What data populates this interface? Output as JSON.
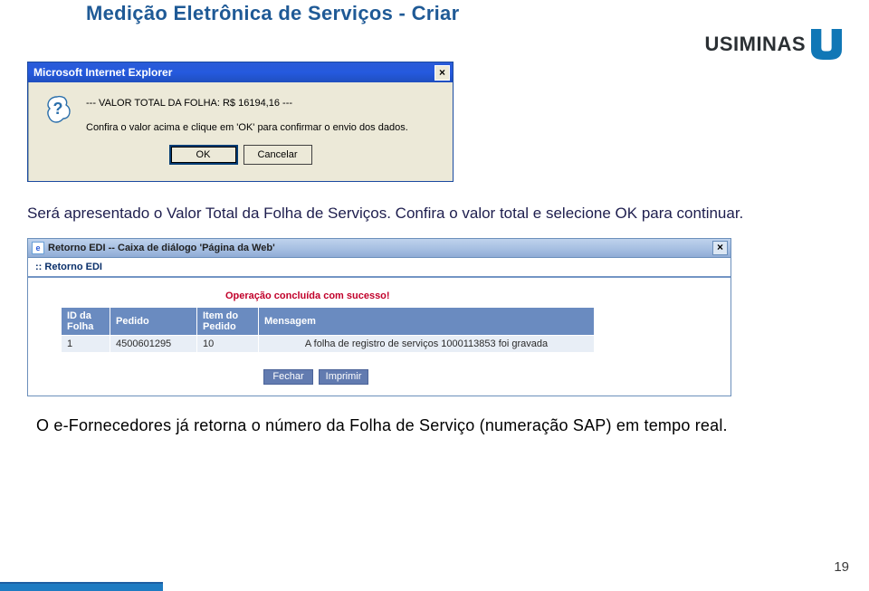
{
  "header": {
    "page_title": "Medição Eletrônica de Serviços - Criar",
    "logo_text": "USIMINAS"
  },
  "ie_dialog": {
    "title": "Microsoft Internet Explorer",
    "line1": "--- VALOR TOTAL DA FOLHA: R$ 16194,16 ---",
    "line2": "Confira o valor acima e clique em 'OK' para confirmar o envio dos dados.",
    "ok_label": "OK",
    "cancel_label": "Cancelar"
  },
  "instruction": "Será apresentado o Valor Total da Folha de Serviços. Confira o valor total e selecione OK para continuar.",
  "web_dialog": {
    "titlebar": "Retorno EDI -- Caixa de diálogo 'Página da Web'",
    "retorno_label": ":: Retorno EDI",
    "success_message": "Operação concluída com sucesso!",
    "table": {
      "headers": {
        "id": "ID da Folha",
        "pedido": "Pedido",
        "item": "Item do Pedido",
        "mensagem": "Mensagem"
      },
      "row": {
        "id": "1",
        "pedido": "4500601295",
        "item": "10",
        "mensagem": "A folha de registro de serviços 1000113853 foi gravada"
      }
    },
    "fechar_label": "Fechar",
    "imprimir_label": "Imprimir"
  },
  "summary": "O e-Fornecedores já retorna o número da Folha de Serviço (numeração SAP) em tempo real.",
  "page_number": "19"
}
